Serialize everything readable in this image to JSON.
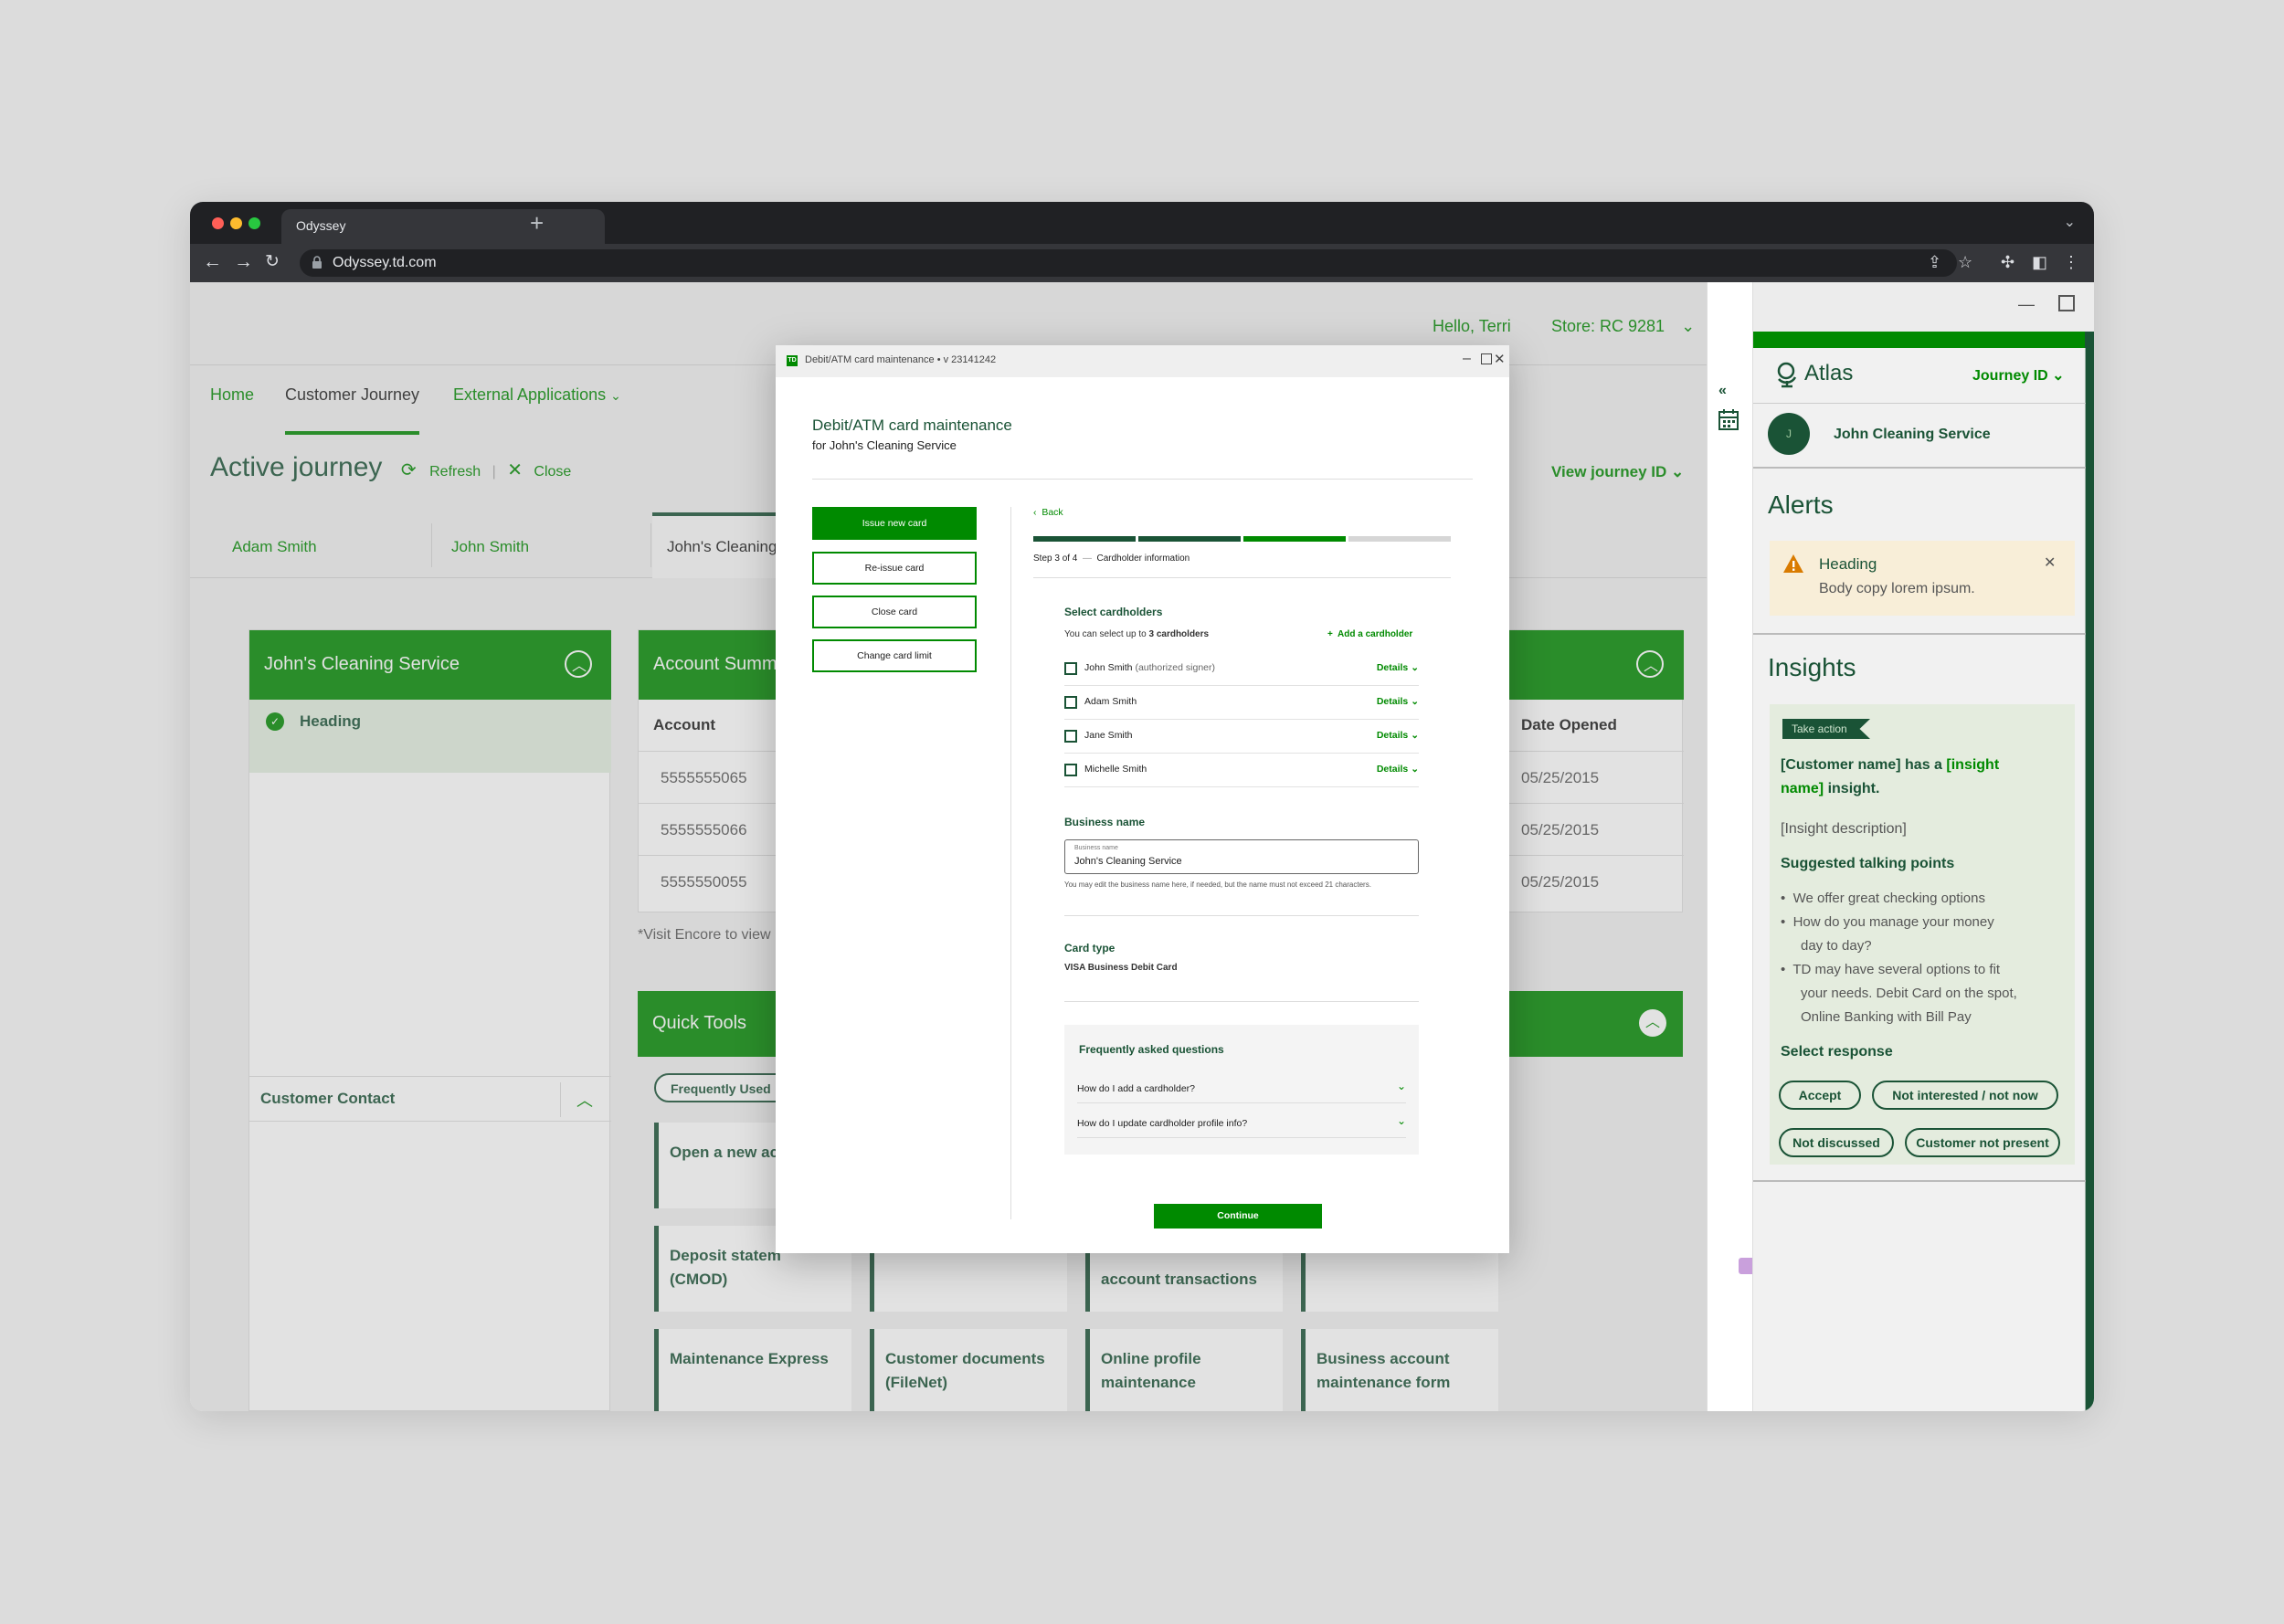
{
  "browser": {
    "tab_title": "Odyssey",
    "url": "Odyssey.td.com",
    "new_tab": "+"
  },
  "app": {
    "greeting": "Hello, Terri",
    "store": "Store: RC 9281",
    "nav": {
      "home": "Home",
      "customer_journey": "Customer Journey",
      "external_apps": "External Applications"
    },
    "title": "Active journey",
    "refresh": "Refresh",
    "close": "Close",
    "view_journey": "View journey ID",
    "customer_tabs": [
      "Adam Smith",
      "John Smith",
      "John's Cleaning"
    ],
    "left_card": {
      "title": "John's Cleaning Service",
      "heading": "Heading",
      "contact": "Customer Contact"
    },
    "account_summary": {
      "title": "Account Summ",
      "col_account": "Account",
      "col_date": "Date Opened",
      "accounts": [
        "5555555065",
        "5555555066",
        "5555550055"
      ],
      "dates": [
        "05/25/2015",
        "05/25/2015",
        "05/25/2015"
      ],
      "footnote": "*Visit Encore to view"
    },
    "quick_tools": {
      "title": "Quick Tools",
      "chip": "Frequently Used",
      "tools": [
        "Open a new ac",
        "Deposit statem\n(CMOD)",
        "account transactions",
        "Maintenance Express",
        "Customer documents (FileNet)",
        "Online profile maintenance",
        "Business account maintenance form"
      ]
    }
  },
  "atlas": {
    "brand": "Atlas",
    "journey_id": "Journey ID",
    "avatar_initial": "J",
    "customer": "John Cleaning Service",
    "alerts_title": "Alerts",
    "alert": {
      "heading": "Heading",
      "body": "Body copy lorem ipsum."
    },
    "insights_title": "Insights",
    "take_action": "Take action",
    "insight_line1a": "[Customer name] has a ",
    "insight_line1b": "[insight",
    "insight_line2a": "name]",
    "insight_line2b": " insight.",
    "insight_desc": "[Insight description]",
    "talking_title": "Suggested talking points",
    "talking_points": [
      "We offer great checking options",
      "How do you manage your money",
      "day to day?",
      "TD may have several options to fit",
      "your needs. Debit Card on the spot,",
      "Online Banking with Bill Pay"
    ],
    "select_response": "Select response",
    "responses": [
      "Accept",
      "Not interested / not now",
      "Not discussed",
      "Customer not present"
    ]
  },
  "modal": {
    "window_title": "Debit/ATM card maintenance • v 23141242",
    "td": "TD",
    "title": "Debit/ATM card maintenance",
    "subtitle": "for John's Cleaning Service",
    "actions": [
      "Issue new card",
      "Re-issue card",
      "Close card",
      "Change card limit"
    ],
    "back": "Back",
    "step": "Step 3 of 4",
    "step_dash": "—",
    "step_name": "Cardholder information",
    "progress_steps": 4,
    "progress_current": 3,
    "select_title": "Select cardholders",
    "select_hint_a": "You can select up to ",
    "select_hint_b": "3 cardholders",
    "add_cardholder": "Add a cardholder",
    "cardholders": [
      {
        "name": "John Smith",
        "note": " (authorized signer)"
      },
      {
        "name": "Adam Smith",
        "note": ""
      },
      {
        "name": "Jane Smith",
        "note": ""
      },
      {
        "name": "Michelle Smith",
        "note": ""
      }
    ],
    "details": "Details",
    "business_label": "Business name",
    "business_field_label": "Business name",
    "business_value": "John's Cleaning Service",
    "business_help": "You may edit the business name here, if needed, but the name must not exceed 21 characters.",
    "card_type_label": "Card type",
    "card_type_value": "VISA Business Debit Card",
    "faq_title": "Frequently asked questions",
    "faqs": [
      "How do I add a cardholder?",
      "How do I update cardholder profile info?"
    ],
    "continue": "Continue"
  },
  "colors": {
    "td_green": "#008a00",
    "dark_green": "#1a5336",
    "light_green": "#e2efe0",
    "alert_bg": "#fdf4e0"
  }
}
